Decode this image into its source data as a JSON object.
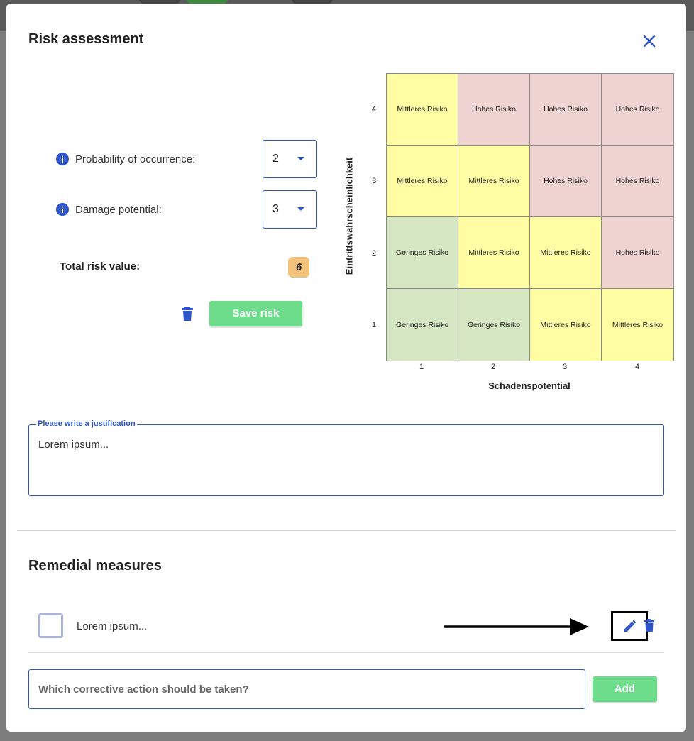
{
  "modal": {
    "title": "Risk assessment",
    "close_icon": "close-icon"
  },
  "fields": {
    "probability": {
      "label": "Probability of occurrence:",
      "value": "2"
    },
    "damage": {
      "label": "Damage potential:",
      "value": "3"
    },
    "total": {
      "label": "Total risk value:",
      "value": "6"
    }
  },
  "actions": {
    "save_risk": "Save risk",
    "add": "Add"
  },
  "colors": {
    "accent": "#2d55c8",
    "save_button": "#6ddc8b",
    "badge": "#f4c37b",
    "low": "#d6e7c4",
    "medium": "#fffda4",
    "high": "#eed3d1"
  },
  "chart_data": {
    "type": "heatmap",
    "xlabel": "Schadenspotential",
    "ylabel": "Eintrittswahrscheinlichkeit",
    "x_ticks": [
      "1",
      "2",
      "3",
      "4"
    ],
    "y_ticks": [
      "4",
      "3",
      "2",
      "1"
    ],
    "rows": [
      [
        "Mittleres Risiko",
        "Hohes Risiko",
        "Hohes Risiko",
        "Hohes Risiko"
      ],
      [
        "Mittleres Risiko",
        "Mittleres Risiko",
        "Hohes Risiko",
        "Hohes Risiko"
      ],
      [
        "Geringes Risiko",
        "Mittleres Risiko",
        "Mittleres Risiko",
        "Hohes Risiko"
      ],
      [
        "Geringes Risiko",
        "Geringes Risiko",
        "Mittleres Risiko",
        "Mittleres Risiko"
      ]
    ]
  },
  "justification": {
    "legend": "Please write a justification",
    "text": "Lorem ipsum..."
  },
  "remedial": {
    "title": "Remedial measures",
    "items": [
      {
        "text": "Lorem ipsum..."
      }
    ],
    "input_placeholder": "Which corrective action should be taken?"
  }
}
